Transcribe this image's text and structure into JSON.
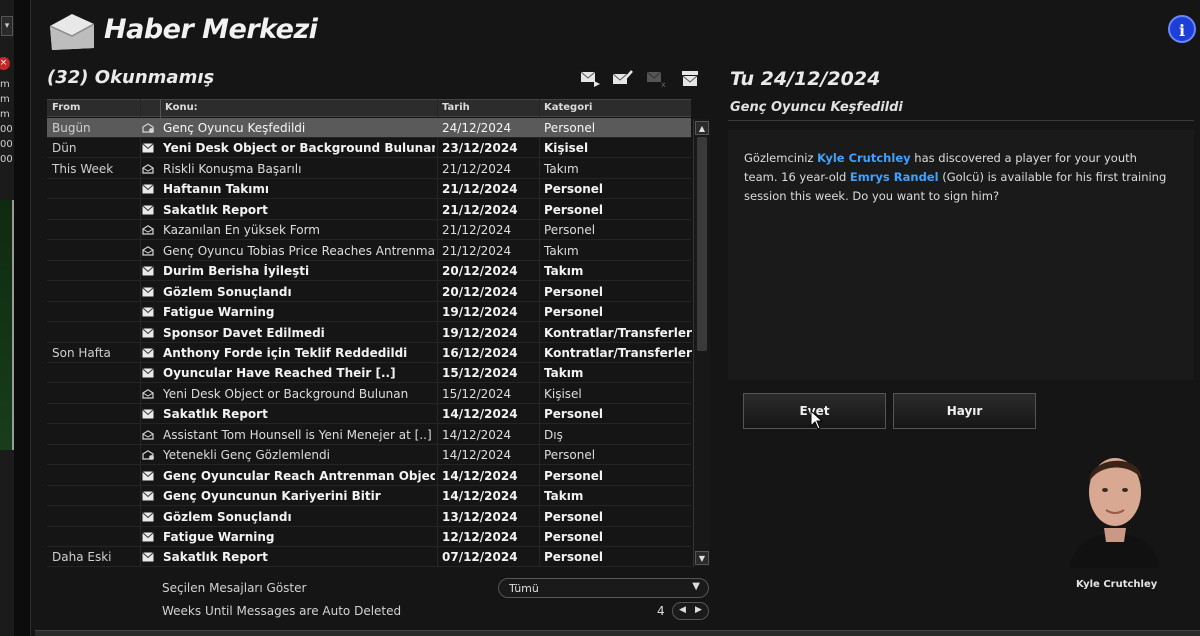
{
  "app": {
    "title": "Haber Merkezi",
    "info_label": "i"
  },
  "left_strip": {
    "caret": "▾",
    "close_glyph": "×",
    "labels": [
      "m",
      "m",
      "m",
      "00",
      "00",
      "00"
    ]
  },
  "inbox": {
    "unread_title": "(32) Okunmamış",
    "toolbar_icons": [
      "forward-mail-icon",
      "mark-read-icon",
      "delete-mail-icon",
      "archive-mail-icon"
    ],
    "columns": {
      "from": "From",
      "subject": "Konu:",
      "date": "Tarih",
      "category": "Kategori"
    },
    "rows": [
      {
        "group": "Bugün",
        "icon": "special",
        "subject": "Genç Oyuncu Keşfedildi",
        "date": "24/12/2024",
        "category": "Personel",
        "bold": false,
        "selected": true
      },
      {
        "group": "Dün",
        "icon": "mail",
        "subject": "Yeni Desk Object or Background Bulunan",
        "date": "23/12/2024",
        "category": "Kişisel",
        "bold": true,
        "selected": false
      },
      {
        "group": "This Week",
        "icon": "opened",
        "subject": "Riskli Konuşma Başarılı",
        "date": "21/12/2024",
        "category": "Takım",
        "bold": false,
        "selected": false
      },
      {
        "group": "",
        "icon": "mail",
        "subject": "Haftanın Takımı",
        "date": "21/12/2024",
        "category": "Personel",
        "bold": true,
        "selected": false
      },
      {
        "group": "",
        "icon": "mail",
        "subject": "Sakatlık Report",
        "date": "21/12/2024",
        "category": "Personel",
        "bold": true,
        "selected": false
      },
      {
        "group": "",
        "icon": "opened",
        "subject": "Kazanılan En yüksek Form",
        "date": "21/12/2024",
        "category": "Personel",
        "bold": false,
        "selected": false
      },
      {
        "group": "",
        "icon": "opened",
        "subject": "Genç Oyuncu Tobias Price Reaches Antrenman [..]",
        "date": "21/12/2024",
        "category": "Takım",
        "bold": false,
        "selected": false
      },
      {
        "group": "",
        "icon": "mail",
        "subject": "Durim Berisha İyileşti",
        "date": "20/12/2024",
        "category": "Takım",
        "bold": true,
        "selected": false
      },
      {
        "group": "",
        "icon": "mail",
        "subject": "Gözlem Sonuçlandı",
        "date": "20/12/2024",
        "category": "Personel",
        "bold": true,
        "selected": false
      },
      {
        "group": "",
        "icon": "mail",
        "subject": "Fatigue Warning",
        "date": "19/12/2024",
        "category": "Personel",
        "bold": true,
        "selected": false
      },
      {
        "group": "",
        "icon": "mail",
        "subject": "Sponsor Davet Edilmedi",
        "date": "19/12/2024",
        "category": "Kontratlar/Transferler",
        "bold": true,
        "selected": false
      },
      {
        "group": "Son Hafta",
        "icon": "mail",
        "subject": "Anthony Forde için Teklif Reddedildi",
        "date": "16/12/2024",
        "category": "Kontratlar/Transferler",
        "bold": true,
        "selected": false
      },
      {
        "group": "",
        "icon": "mail",
        "subject": "Oyuncular Have Reached Their [..]",
        "date": "15/12/2024",
        "category": "Takım",
        "bold": true,
        "selected": false
      },
      {
        "group": "",
        "icon": "opened",
        "subject": "Yeni Desk Object or Background Bulunan",
        "date": "15/12/2024",
        "category": "Kişisel",
        "bold": false,
        "selected": false
      },
      {
        "group": "",
        "icon": "mail",
        "subject": "Sakatlık Report",
        "date": "14/12/2024",
        "category": "Personel",
        "bold": true,
        "selected": false
      },
      {
        "group": "",
        "icon": "opened",
        "subject": "Assistant Tom Hounsell is Yeni Menejer at [..]",
        "date": "14/12/2024",
        "category": "Dış",
        "bold": false,
        "selected": false
      },
      {
        "group": "",
        "icon": "special",
        "subject": "Yetenekli Genç Gözlemlendi",
        "date": "14/12/2024",
        "category": "Personel",
        "bold": false,
        "selected": false
      },
      {
        "group": "",
        "icon": "mail",
        "subject": "Genç Oyuncular Reach Antrenman Objective",
        "date": "14/12/2024",
        "category": "Personel",
        "bold": true,
        "selected": false
      },
      {
        "group": "",
        "icon": "mail",
        "subject": "Genç Oyuncunun Kariyerini Bitir",
        "date": "14/12/2024",
        "category": "Takım",
        "bold": true,
        "selected": false
      },
      {
        "group": "",
        "icon": "mail",
        "subject": "Gözlem Sonuçlandı",
        "date": "13/12/2024",
        "category": "Personel",
        "bold": true,
        "selected": false
      },
      {
        "group": "",
        "icon": "mail",
        "subject": "Fatigue Warning",
        "date": "12/12/2024",
        "category": "Personel",
        "bold": true,
        "selected": false
      },
      {
        "group": "Daha Eski",
        "icon": "mail",
        "subject": "Sakatlık Report",
        "date": "07/12/2024",
        "category": "Personel",
        "bold": true,
        "selected": false
      }
    ],
    "footer": {
      "show_label": "Seçilen Mesajları Göster",
      "show_value": "Tümü",
      "weeks_label": "Weeks Until Messages are Auto Deleted",
      "weeks_value": "4"
    }
  },
  "message": {
    "date": "Tu 24/12/2024",
    "subject": "Genç Oyuncu Keşfedildi",
    "body_part1": "Gözlemciniz ",
    "scout_name": "Kyle Crutchley",
    "body_part2": " has discovered a player for your youth team. 16 year-old ",
    "player_name": "Emrys Randel",
    "body_part3": " (Golcü) is available for his first training session this week. Do you want to sign him?",
    "yes_label": "Evet",
    "no_label": "Hayır",
    "sender_name": "Kyle Crutchley"
  }
}
